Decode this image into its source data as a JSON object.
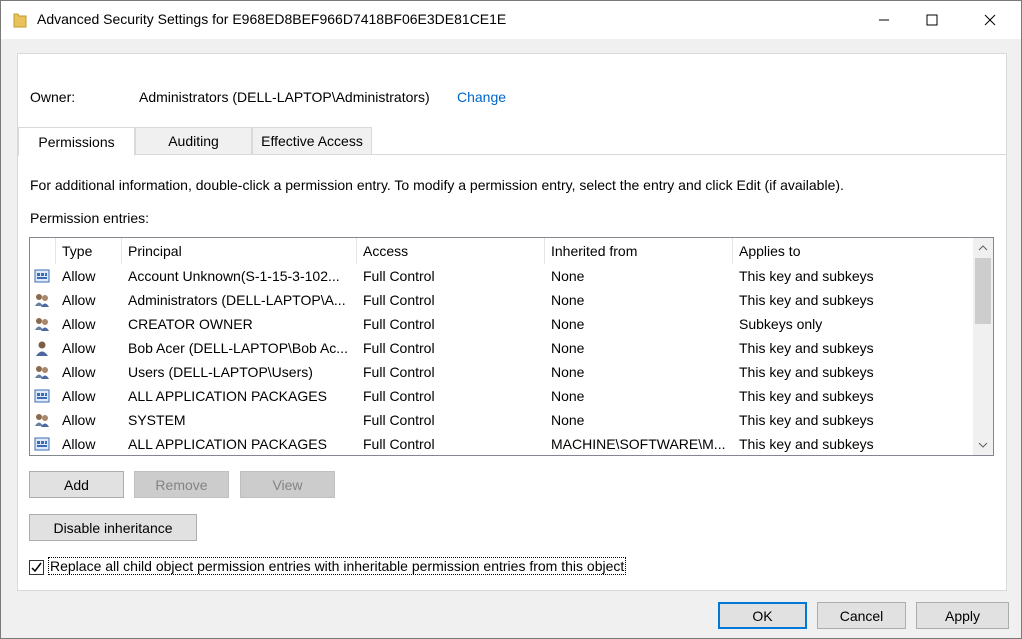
{
  "window": {
    "title": "Advanced Security Settings for E968ED8BEF966D7418BF06E3DE81CE1E"
  },
  "owner": {
    "label": "Owner:",
    "value": "Administrators (DELL-LAPTOP\\Administrators)",
    "change_link": "Change"
  },
  "tabs": [
    {
      "label": "Permissions",
      "active": true
    },
    {
      "label": "Auditing",
      "active": false
    },
    {
      "label": "Effective Access",
      "active": false
    }
  ],
  "info_text": "For additional information, double-click a permission entry. To modify a permission entry, select the entry and click Edit (if available).",
  "entries_label": "Permission entries:",
  "table": {
    "columns": [
      "Type",
      "Principal",
      "Access",
      "Inherited from",
      "Applies to"
    ],
    "rows": [
      {
        "icon": "app-package-icon",
        "type": "Allow",
        "principal": "Account Unknown(S-1-15-3-102...",
        "access": "Full Control",
        "inherited": "None",
        "applies": "This key and subkeys"
      },
      {
        "icon": "group-icon",
        "type": "Allow",
        "principal": "Administrators (DELL-LAPTOP\\A...",
        "access": "Full Control",
        "inherited": "None",
        "applies": "This key and subkeys"
      },
      {
        "icon": "group-icon",
        "type": "Allow",
        "principal": "CREATOR OWNER",
        "access": "Full Control",
        "inherited": "None",
        "applies": "Subkeys only"
      },
      {
        "icon": "user-icon",
        "type": "Allow",
        "principal": "Bob Acer (DELL-LAPTOP\\Bob Ac...",
        "access": "Full Control",
        "inherited": "None",
        "applies": "This key and subkeys"
      },
      {
        "icon": "group-icon",
        "type": "Allow",
        "principal": "Users (DELL-LAPTOP\\Users)",
        "access": "Full Control",
        "inherited": "None",
        "applies": "This key and subkeys"
      },
      {
        "icon": "app-package-icon",
        "type": "Allow",
        "principal": "ALL APPLICATION PACKAGES",
        "access": "Full Control",
        "inherited": "None",
        "applies": "This key and subkeys"
      },
      {
        "icon": "group-icon",
        "type": "Allow",
        "principal": "SYSTEM",
        "access": "Full Control",
        "inherited": "None",
        "applies": "This key and subkeys"
      },
      {
        "icon": "app-package-icon",
        "type": "Allow",
        "principal": "ALL APPLICATION PACKAGES",
        "access": "Full Control",
        "inherited": "MACHINE\\SOFTWARE\\M...",
        "applies": "This key and subkeys"
      }
    ]
  },
  "buttons": {
    "add": "Add",
    "remove": "Remove",
    "view": "View",
    "disable_inheritance": "Disable inheritance",
    "ok": "OK",
    "cancel": "Cancel",
    "apply": "Apply"
  },
  "replace_checkbox": {
    "label": "Replace all child object permission entries with inheritable permission entries from this object",
    "checked": true
  },
  "colors": {
    "link": "#0066cc",
    "default_button_border": "#0078d7",
    "background": "#f0f0f0"
  }
}
